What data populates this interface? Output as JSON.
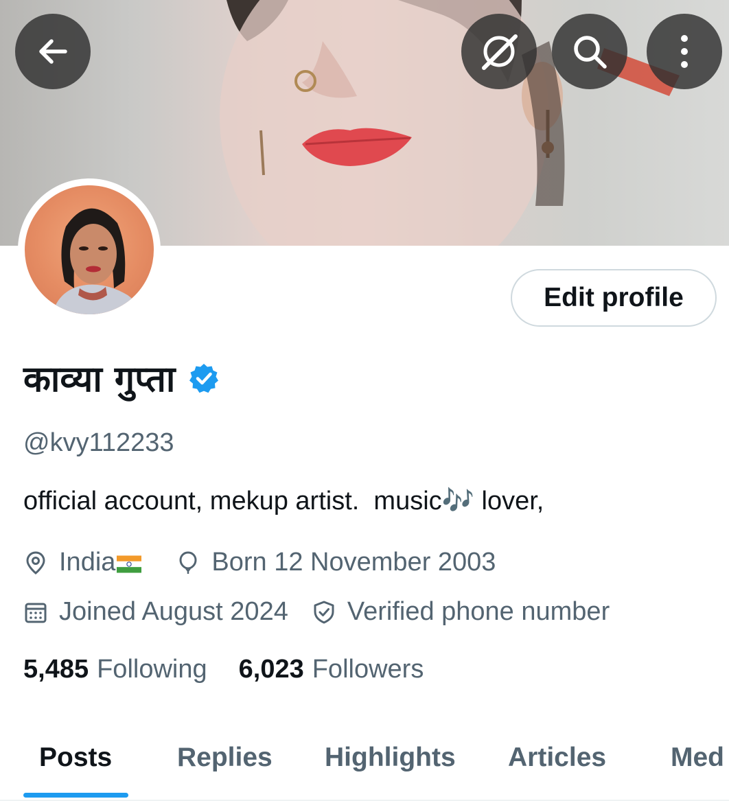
{
  "header": {
    "back_icon": "arrow-left-icon",
    "grok_icon": "grok-icon",
    "search_icon": "search-icon",
    "more_icon": "more-vertical-icon"
  },
  "profile": {
    "name": "काव्या गुप्ता",
    "handle": "@kvy112233",
    "bio": "official account, mekup artist.  music🎶 lover,",
    "location": "India",
    "birth": "Born 12 November 2003",
    "joined": "Joined August 2024",
    "verified_phone": "Verified phone number",
    "edit_button": "Edit profile",
    "verified_badge_color": "#1d9bf0"
  },
  "stats": {
    "following_count": "5,485",
    "following_label": "Following",
    "followers_count": "6,023",
    "followers_label": "Followers"
  },
  "tabs": [
    {
      "label": "Posts",
      "active": true
    },
    {
      "label": "Replies",
      "active": false
    },
    {
      "label": "Highlights",
      "active": false
    },
    {
      "label": "Articles",
      "active": false
    },
    {
      "label": "Med",
      "active": false
    }
  ],
  "colors": {
    "accent": "#1d9bf0",
    "primary_text": "#0f1419",
    "secondary_text": "#536471"
  }
}
